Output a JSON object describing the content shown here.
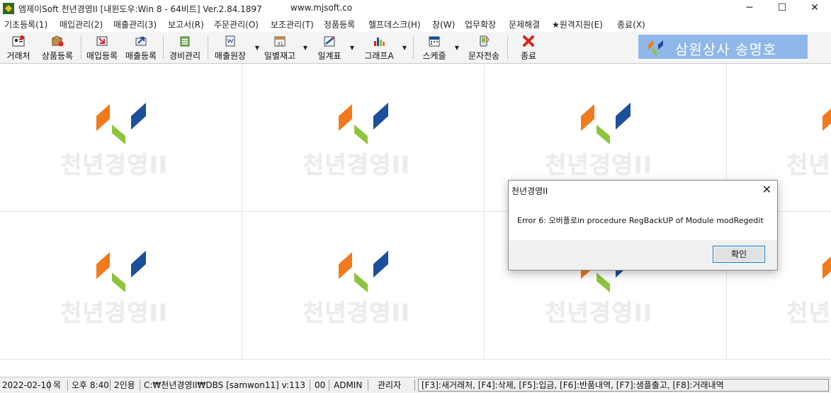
{
  "window": {
    "title": "엠제이Soft 천년경영II [내윈도우:Win 8 - 64비트] Ver.2.84.1897",
    "site": "www.mjsoft.co",
    "minimize": "─",
    "maximize": "☐",
    "close": "✕"
  },
  "menu": [
    "기초등록(1)",
    "매입관리(2)",
    "매출관리(3)",
    "보고서(R)",
    "주문관리(O)",
    "보조관리(T)",
    "정품등록",
    "헬프데스크(H)",
    "창(W)",
    "업무확장",
    "문제해결",
    "★원격지원(E)",
    "종료(X)"
  ],
  "toolbar": {
    "buttons": [
      {
        "label": "거래처",
        "icon": "contacts-icon"
      },
      {
        "label": "상품등록",
        "icon": "product-box-icon"
      },
      {
        "label": "매입등록",
        "icon": "purchase-icon"
      },
      {
        "label": "매출등록",
        "icon": "sales-icon"
      },
      {
        "label": "경비관리",
        "icon": "expense-icon"
      },
      {
        "label": "매출원장",
        "icon": "ledger-icon"
      },
      {
        "label": "일별재고",
        "icon": "calendar-stock-icon"
      },
      {
        "label": "일계표",
        "icon": "daily-report-icon"
      },
      {
        "label": "그래프A",
        "icon": "bar-chart-icon"
      },
      {
        "label": "스케줄",
        "icon": "schedule-icon"
      },
      {
        "label": "문자전송",
        "icon": "sms-icon"
      },
      {
        "label": "종료",
        "icon": "exit-x-icon"
      }
    ],
    "dropdown_arrow": "▼"
  },
  "banner": {
    "text": "삼원상사 송명호"
  },
  "watermark": {
    "text": "천년경영II"
  },
  "dialog": {
    "title": "천년경영II",
    "close": "✕",
    "message": "Error 6: 오버플로in procedure RegBackUP of Module modRegedit",
    "ok_label": "확인"
  },
  "status": {
    "date": "2022-02-10",
    "weekday": "목",
    "time": "오후 8:40",
    "users": "2인용",
    "path": "C:₩천년경영II₩DBS [samwon11] v:113",
    "code": "00",
    "user": "ADMIN",
    "role": "관리자",
    "shortcuts": "[F3]:새거래처, [F4]:삭제, [F5]:입금, [F6]:반품내역, [F7]:샘플출고, [F8]:거래내역"
  },
  "colors": {
    "logo_orange": "#f07a1c",
    "logo_green": "#8cc43c",
    "logo_blue": "#1c4f9c",
    "banner_bg": "#8fb7e9",
    "exit_red": "#d9261c"
  }
}
